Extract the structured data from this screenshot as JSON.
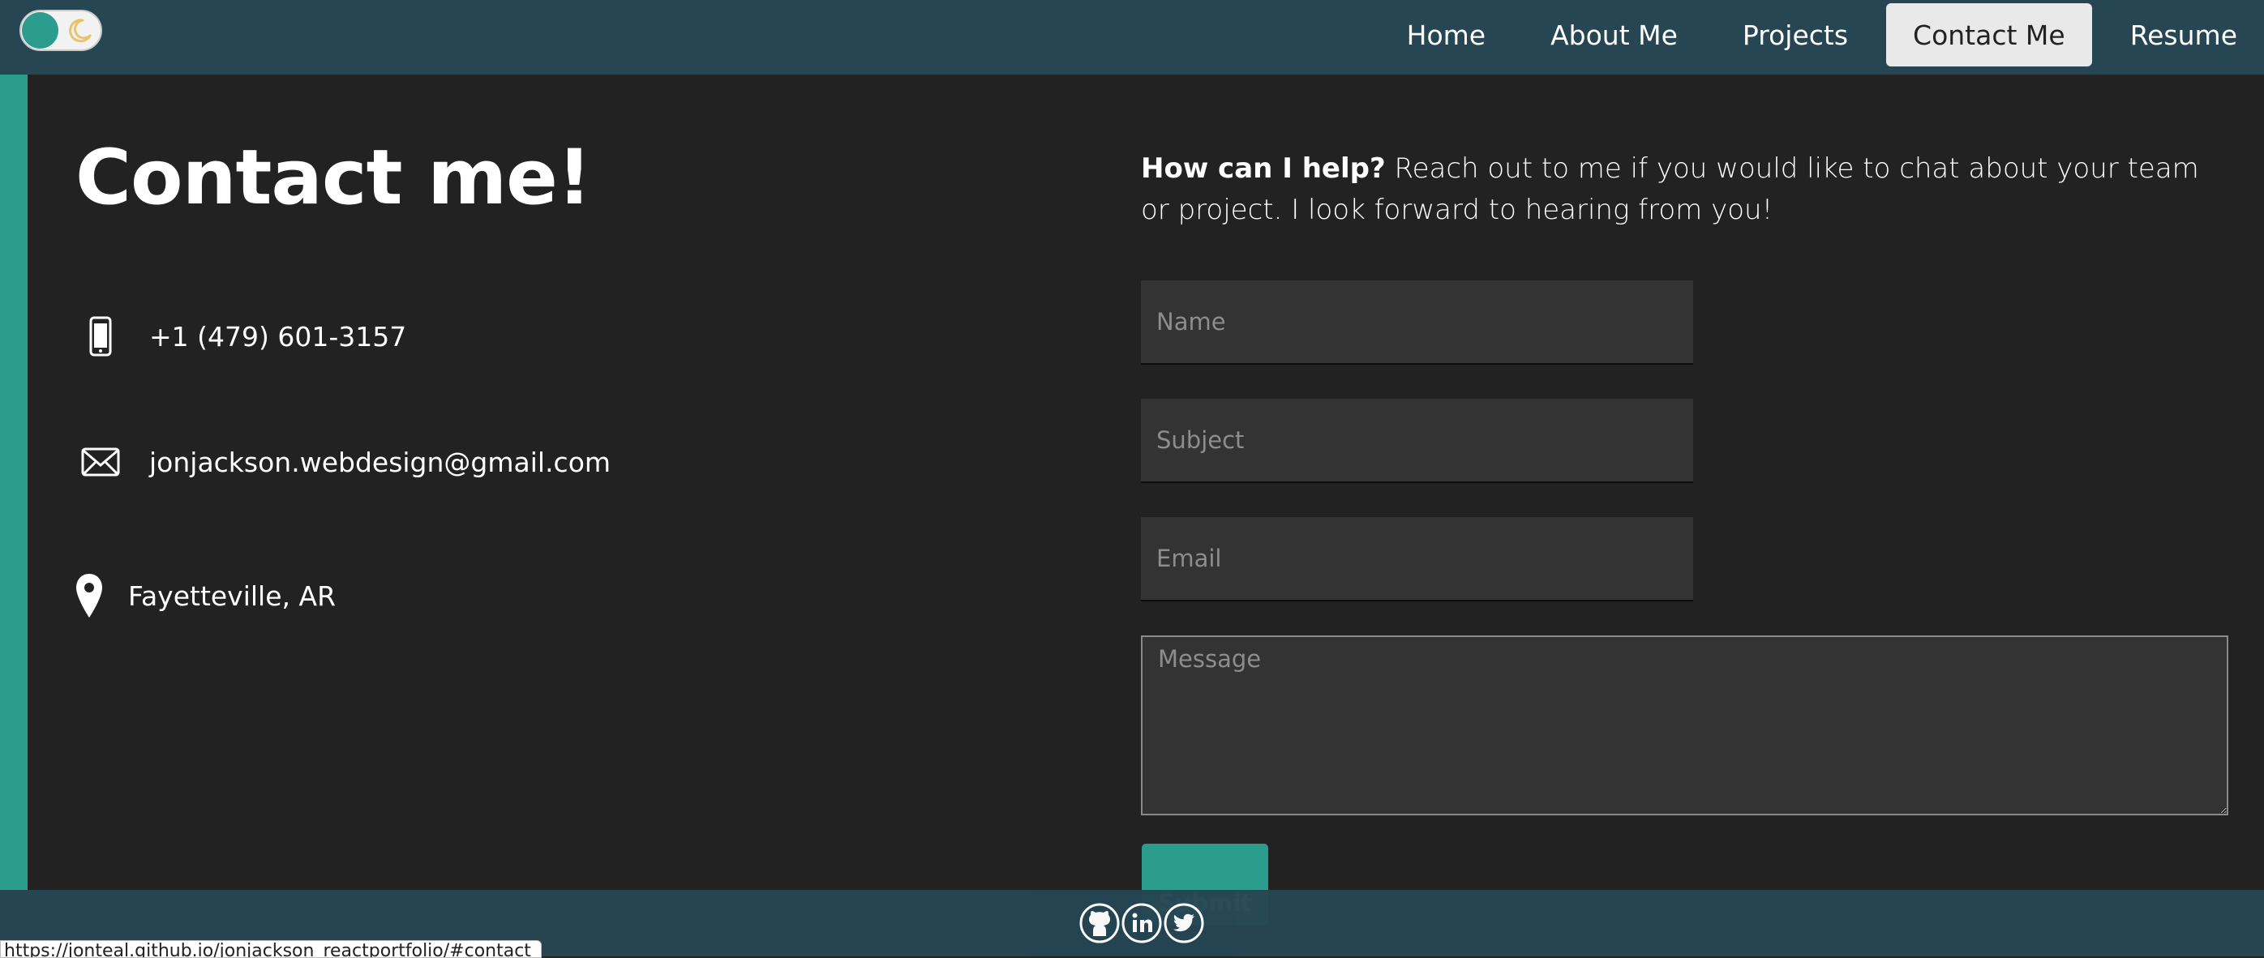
{
  "theme_toggle": {
    "icon": "moon-icon",
    "accent": "#2a9d8f"
  },
  "nav": {
    "links": [
      "Home",
      "About Me",
      "Projects",
      "Contact Me",
      "Resume"
    ],
    "active": "Contact Me"
  },
  "contact": {
    "title": "Contact me!",
    "phone": "+1 (479) 601-3157",
    "email": "jonjackson.webdesign@gmail.com",
    "location": "Fayetteville, AR",
    "icons": [
      "phone-icon",
      "mail-icon",
      "map-pin-icon"
    ]
  },
  "form": {
    "intro_bold": "How can I help?",
    "intro_text": " Reach out to me if you would like to chat about your team or project. I look forward to hearing from you!",
    "name_placeholder": "Name",
    "subject_placeholder": "Subject",
    "email_placeholder": "Email",
    "message_placeholder": "Message",
    "submit_label": "Submit"
  },
  "footer": {
    "social_icons": [
      "github-icon",
      "linkedin-icon",
      "twitter-icon"
    ]
  },
  "status_bar": {
    "url": "https://jonteal.github.io/jonjackson_reactportfolio/#contact"
  },
  "colors": {
    "nav_bg": "#264653",
    "accent": "#2a9d8f",
    "page_bg": "#222222",
    "field_bg": "#333333"
  }
}
